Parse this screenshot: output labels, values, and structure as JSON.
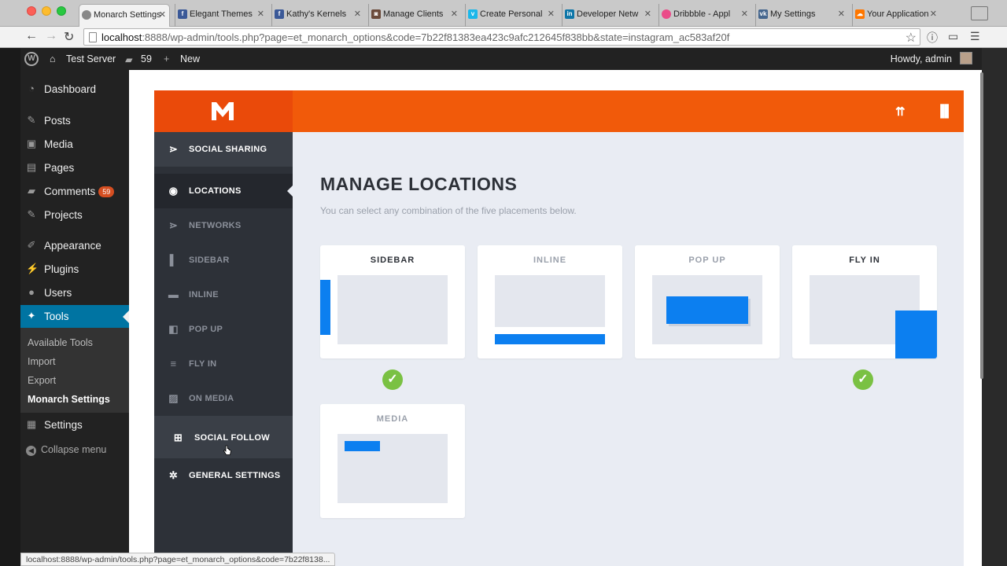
{
  "browser": {
    "tabs": [
      {
        "label": "Monarch Settings",
        "favicon_color": "#888888",
        "active": true
      },
      {
        "label": "Elegant Themes",
        "favicon_color": "#3b5998",
        "active": false
      },
      {
        "label": "Kathy's Kernels",
        "favicon_color": "#3b5998",
        "active": false
      },
      {
        "label": "Manage Clients",
        "favicon_color": "#6b4a3a",
        "active": false
      },
      {
        "label": "Create Personal",
        "favicon_color": "#1ab7ea",
        "active": false
      },
      {
        "label": "Developer Netw",
        "favicon_color": "#0e76a8",
        "active": false
      },
      {
        "label": "Dribbble - Appl",
        "favicon_color": "#ea4c89",
        "active": false
      },
      {
        "label": "My Settings",
        "favicon_color": "#45668e",
        "active": false
      },
      {
        "label": "Your Application",
        "favicon_color": "#ff7700",
        "active": false
      }
    ],
    "url_host": "localhost",
    "url_rest": ":8888/wp-admin/tools.php?page=et_monarch_options&code=7b22f81383ea423c9afc212645f838bb&state=instagram_ac583af20f",
    "status_url": "localhost:8888/wp-admin/tools.php?page=et_monarch_options&code=7b22f8138..."
  },
  "adminbar": {
    "site_name": "Test Server",
    "comments_count": "59",
    "new_label": "New",
    "howdy": "Howdy, admin"
  },
  "wp_menu": {
    "items": [
      {
        "label": "Dashboard",
        "icon": "dashboard-icon"
      },
      {
        "label": "Posts",
        "icon": "pin-icon"
      },
      {
        "label": "Media",
        "icon": "media-icon"
      },
      {
        "label": "Pages",
        "icon": "pages-icon"
      },
      {
        "label": "Comments",
        "icon": "comment-icon",
        "badge": "59"
      },
      {
        "label": "Projects",
        "icon": "pin-icon"
      },
      {
        "label": "Appearance",
        "icon": "brush-icon"
      },
      {
        "label": "Plugins",
        "icon": "plugin-icon"
      },
      {
        "label": "Users",
        "icon": "user-icon"
      },
      {
        "label": "Tools",
        "icon": "wrench-icon",
        "current": true
      },
      {
        "label": "Settings",
        "icon": "settings-icon"
      }
    ],
    "tools_submenu": [
      "Available Tools",
      "Import",
      "Export",
      "Monarch Settings"
    ],
    "collapse_label": "Collapse menu"
  },
  "monarch": {
    "nav": [
      {
        "label": "SOCIAL SHARING",
        "icon": "share-icon"
      },
      {
        "label": "LOCATIONS",
        "icon": "location-icon",
        "active": true
      },
      {
        "label": "NETWORKS",
        "icon": "network-icon"
      },
      {
        "label": "SIDEBAR",
        "icon": "sidebar-icon"
      },
      {
        "label": "INLINE",
        "icon": "inline-icon"
      },
      {
        "label": "POP UP",
        "icon": "popup-icon"
      },
      {
        "label": "FLY IN",
        "icon": "flyin-icon"
      },
      {
        "label": "ON MEDIA",
        "icon": "image-icon"
      },
      {
        "label": "SOCIAL FOLLOW",
        "icon": "plus-icon"
      },
      {
        "label": "GENERAL SETTINGS",
        "icon": "gear-icon"
      }
    ],
    "title": "MANAGE LOCATIONS",
    "subtitle": "You can select any combination of the five placements below.",
    "locations": [
      {
        "label": "SIDEBAR",
        "selected": true
      },
      {
        "label": "INLINE",
        "selected": false
      },
      {
        "label": "POP UP",
        "selected": false
      },
      {
        "label": "FLY IN",
        "selected": true
      },
      {
        "label": "MEDIA",
        "selected": false
      }
    ],
    "colors": {
      "header": "#f15a0a",
      "accent": "#0c7ff0",
      "check": "#7ac143"
    }
  }
}
